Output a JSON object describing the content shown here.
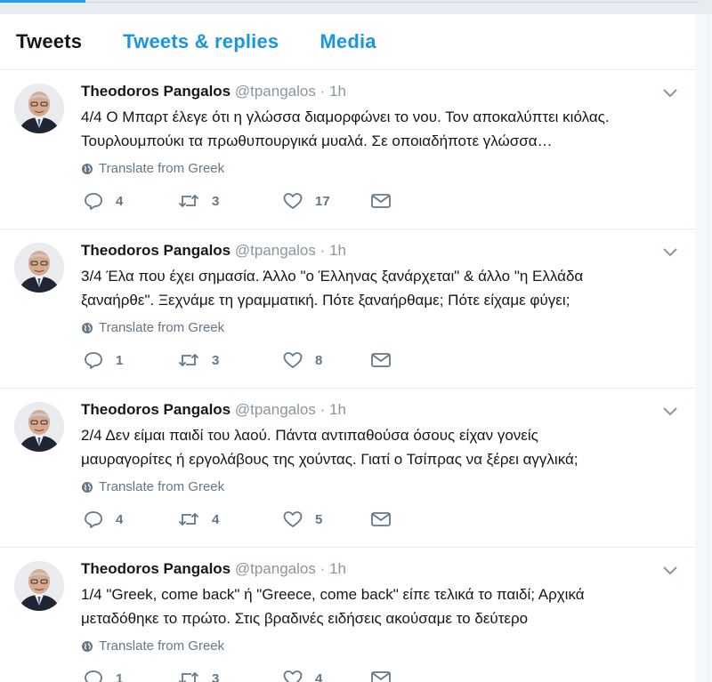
{
  "tabs": [
    {
      "label": "Tweets",
      "active": true
    },
    {
      "label": "Tweets & replies",
      "active": false
    },
    {
      "label": "Media",
      "active": false
    }
  ],
  "tweets": [
    {
      "name": "Theodoros Pangalos",
      "handle": "@tpangalos",
      "dot": "·",
      "time": "1h",
      "line1": "4/4 Ο Μπαρτ έλεγε ότι η γλώσσα διαμορφώνει το νου. Τον αποκαλύπτει κιόλας.",
      "line2": "Τουρλουμπούκι τα πρωθυπουργικά μυαλά. Σε οποιαδήποτε γλώσσα…",
      "translate": "Translate from Greek",
      "replies": "4",
      "retweets": "3",
      "likes": "17"
    },
    {
      "name": "Theodoros Pangalos",
      "handle": "@tpangalos",
      "dot": "·",
      "time": "1h",
      "line1": "3/4 Έλα που έχει σημασία. Άλλο \"ο Έλληνας ξανάρχεται\" & άλλο \"η Ελλάδα",
      "line2": "ξαναήρθε\". Ξεχνάμε τη γραμματική. Πότε ξαναήρθαμε; Πότε είχαμε φύγει;",
      "translate": "Translate from Greek",
      "replies": "1",
      "retweets": "3",
      "likes": "8"
    },
    {
      "name": "Theodoros Pangalos",
      "handle": "@tpangalos",
      "dot": "·",
      "time": "1h",
      "line1": "2/4 Δεν είμαι παιδί του λαού. Πάντα αντιπαθούσα όσους είχαν γονείς",
      "line2": "μαυραγορίτες ή εργολάβους της χούντας. Γιατί ο Τσίπρας να ξέρει αγγλικά;",
      "translate": "Translate from Greek",
      "replies": "4",
      "retweets": "4",
      "likes": "5"
    },
    {
      "name": "Theodoros Pangalos",
      "handle": "@tpangalos",
      "dot": "·",
      "time": "1h",
      "line1": "1/4 \"Greek, come back\" ή \"Greece, come back\" είπε τελικά το παιδί; Αρχικά",
      "line2": "μεταδόθηκε το πρώτο. Στις βραδινές ειδήσεις ακούσαμε το δεύτερο",
      "translate": "Translate from Greek",
      "replies": "1",
      "retweets": "3",
      "likes": "4"
    }
  ],
  "colors": {
    "accent": "#1da1f2",
    "tab_link": "#1b95e0",
    "muted": "#657786",
    "background": "#e6ecf0"
  },
  "icons": [
    "reply-icon",
    "retweet-icon",
    "like-icon",
    "message-icon",
    "globe-icon",
    "chevron-down-icon"
  ]
}
